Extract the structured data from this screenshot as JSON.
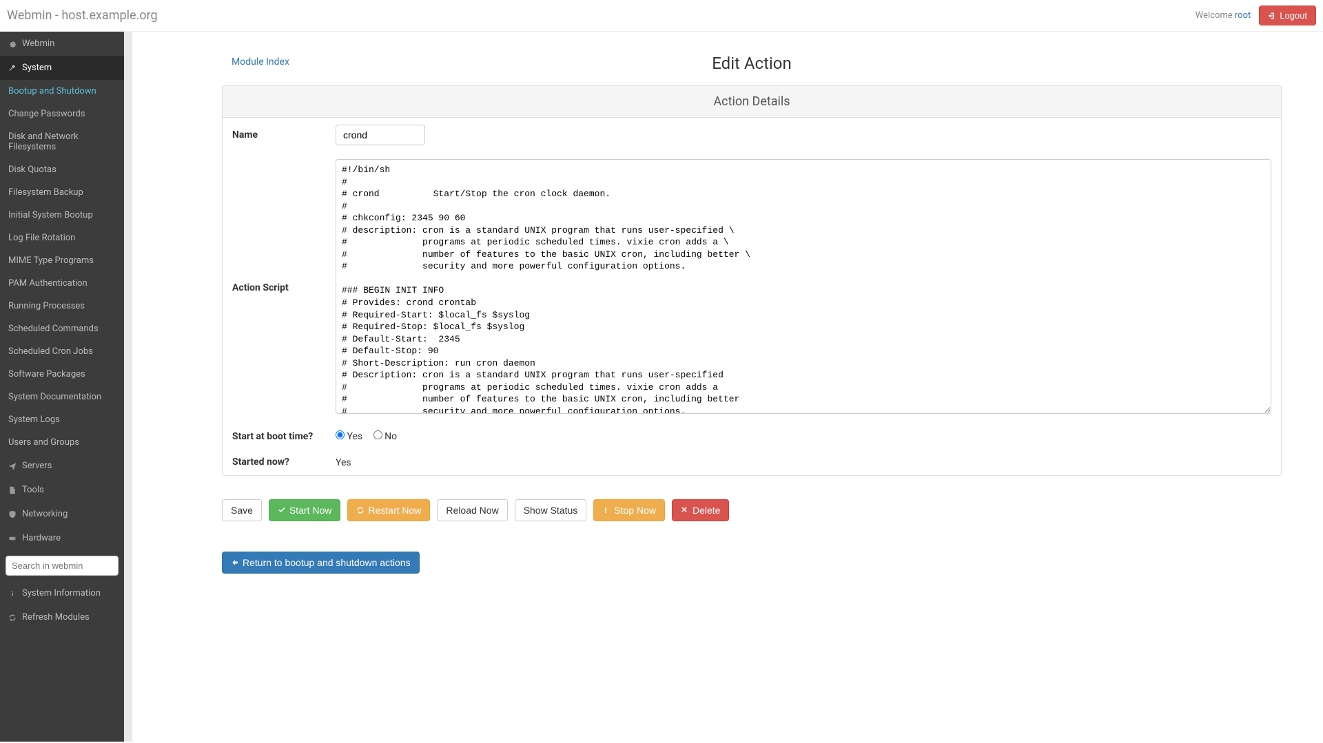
{
  "topbar": {
    "title": "Webmin - host.example.org",
    "welcome_prefix": "Welcome ",
    "user": "root",
    "logout_label": "Logout"
  },
  "sidebar": {
    "categories": [
      {
        "icon": "gear",
        "label": "Webmin"
      },
      {
        "icon": "wrench",
        "label": "System"
      },
      {
        "icon": "send",
        "label": "Servers"
      },
      {
        "icon": "file",
        "label": "Tools"
      },
      {
        "icon": "shield",
        "label": "Networking"
      },
      {
        "icon": "hdd",
        "label": "Hardware"
      }
    ],
    "system_items": [
      "Bootup and Shutdown",
      "Change Passwords",
      "Disk and Network Filesystems",
      "Disk Quotas",
      "Filesystem Backup",
      "Initial System Bootup",
      "Log File Rotation",
      "MIME Type Programs",
      "PAM Authentication",
      "Running Processes",
      "Scheduled Commands",
      "Scheduled Cron Jobs",
      "Software Packages",
      "System Documentation",
      "System Logs",
      "Users and Groups"
    ],
    "search_placeholder": "Search in webmin",
    "footer": [
      {
        "icon": "info",
        "label": "System Information"
      },
      {
        "icon": "refresh",
        "label": "Refresh Modules"
      }
    ]
  },
  "main": {
    "module_index": "Module Index",
    "page_title": "Edit Action",
    "panel_title": "Action Details",
    "labels": {
      "name": "Name",
      "script": "Action Script",
      "start_boot": "Start at boot time?",
      "started_now": "Started now?"
    },
    "name_value": "crond",
    "script_value": "#!/bin/sh\n#\n# crond          Start/Stop the cron clock daemon.\n#\n# chkconfig: 2345 90 60\n# description: cron is a standard UNIX program that runs user-specified \\\n#              programs at periodic scheduled times. vixie cron adds a \\\n#              number of features to the basic UNIX cron, including better \\\n#              security and more powerful configuration options.\n\n### BEGIN INIT INFO\n# Provides: crond crontab\n# Required-Start: $local_fs $syslog\n# Required-Stop: $local_fs $syslog\n# Default-Start:  2345\n# Default-Stop: 90\n# Short-Description: run cron daemon\n# Description: cron is a standard UNIX program that runs user-specified\n#              programs at periodic scheduled times. vixie cron adds a\n#              number of features to the basic UNIX cron, including better\n#              security and more powerful configuration options.\n### END INIT INFO\n\n[ -f /etc/sysconfig/crond ] || {\n    [ \"$1\" = \"status\" ] && exit 4 || exit 6\n}\n\nRETVAL=0\nprog=\"crond\"\nexec=/usr/sbin/crond",
    "boot_yes": "Yes",
    "boot_no": "No",
    "started_value": "Yes",
    "buttons": {
      "save": "Save",
      "start": "Start Now",
      "restart": "Restart Now",
      "reload": "Reload Now",
      "status": "Show Status",
      "stop": "Stop Now",
      "delete": "Delete"
    },
    "return_link": "Return to bootup and shutdown actions"
  }
}
